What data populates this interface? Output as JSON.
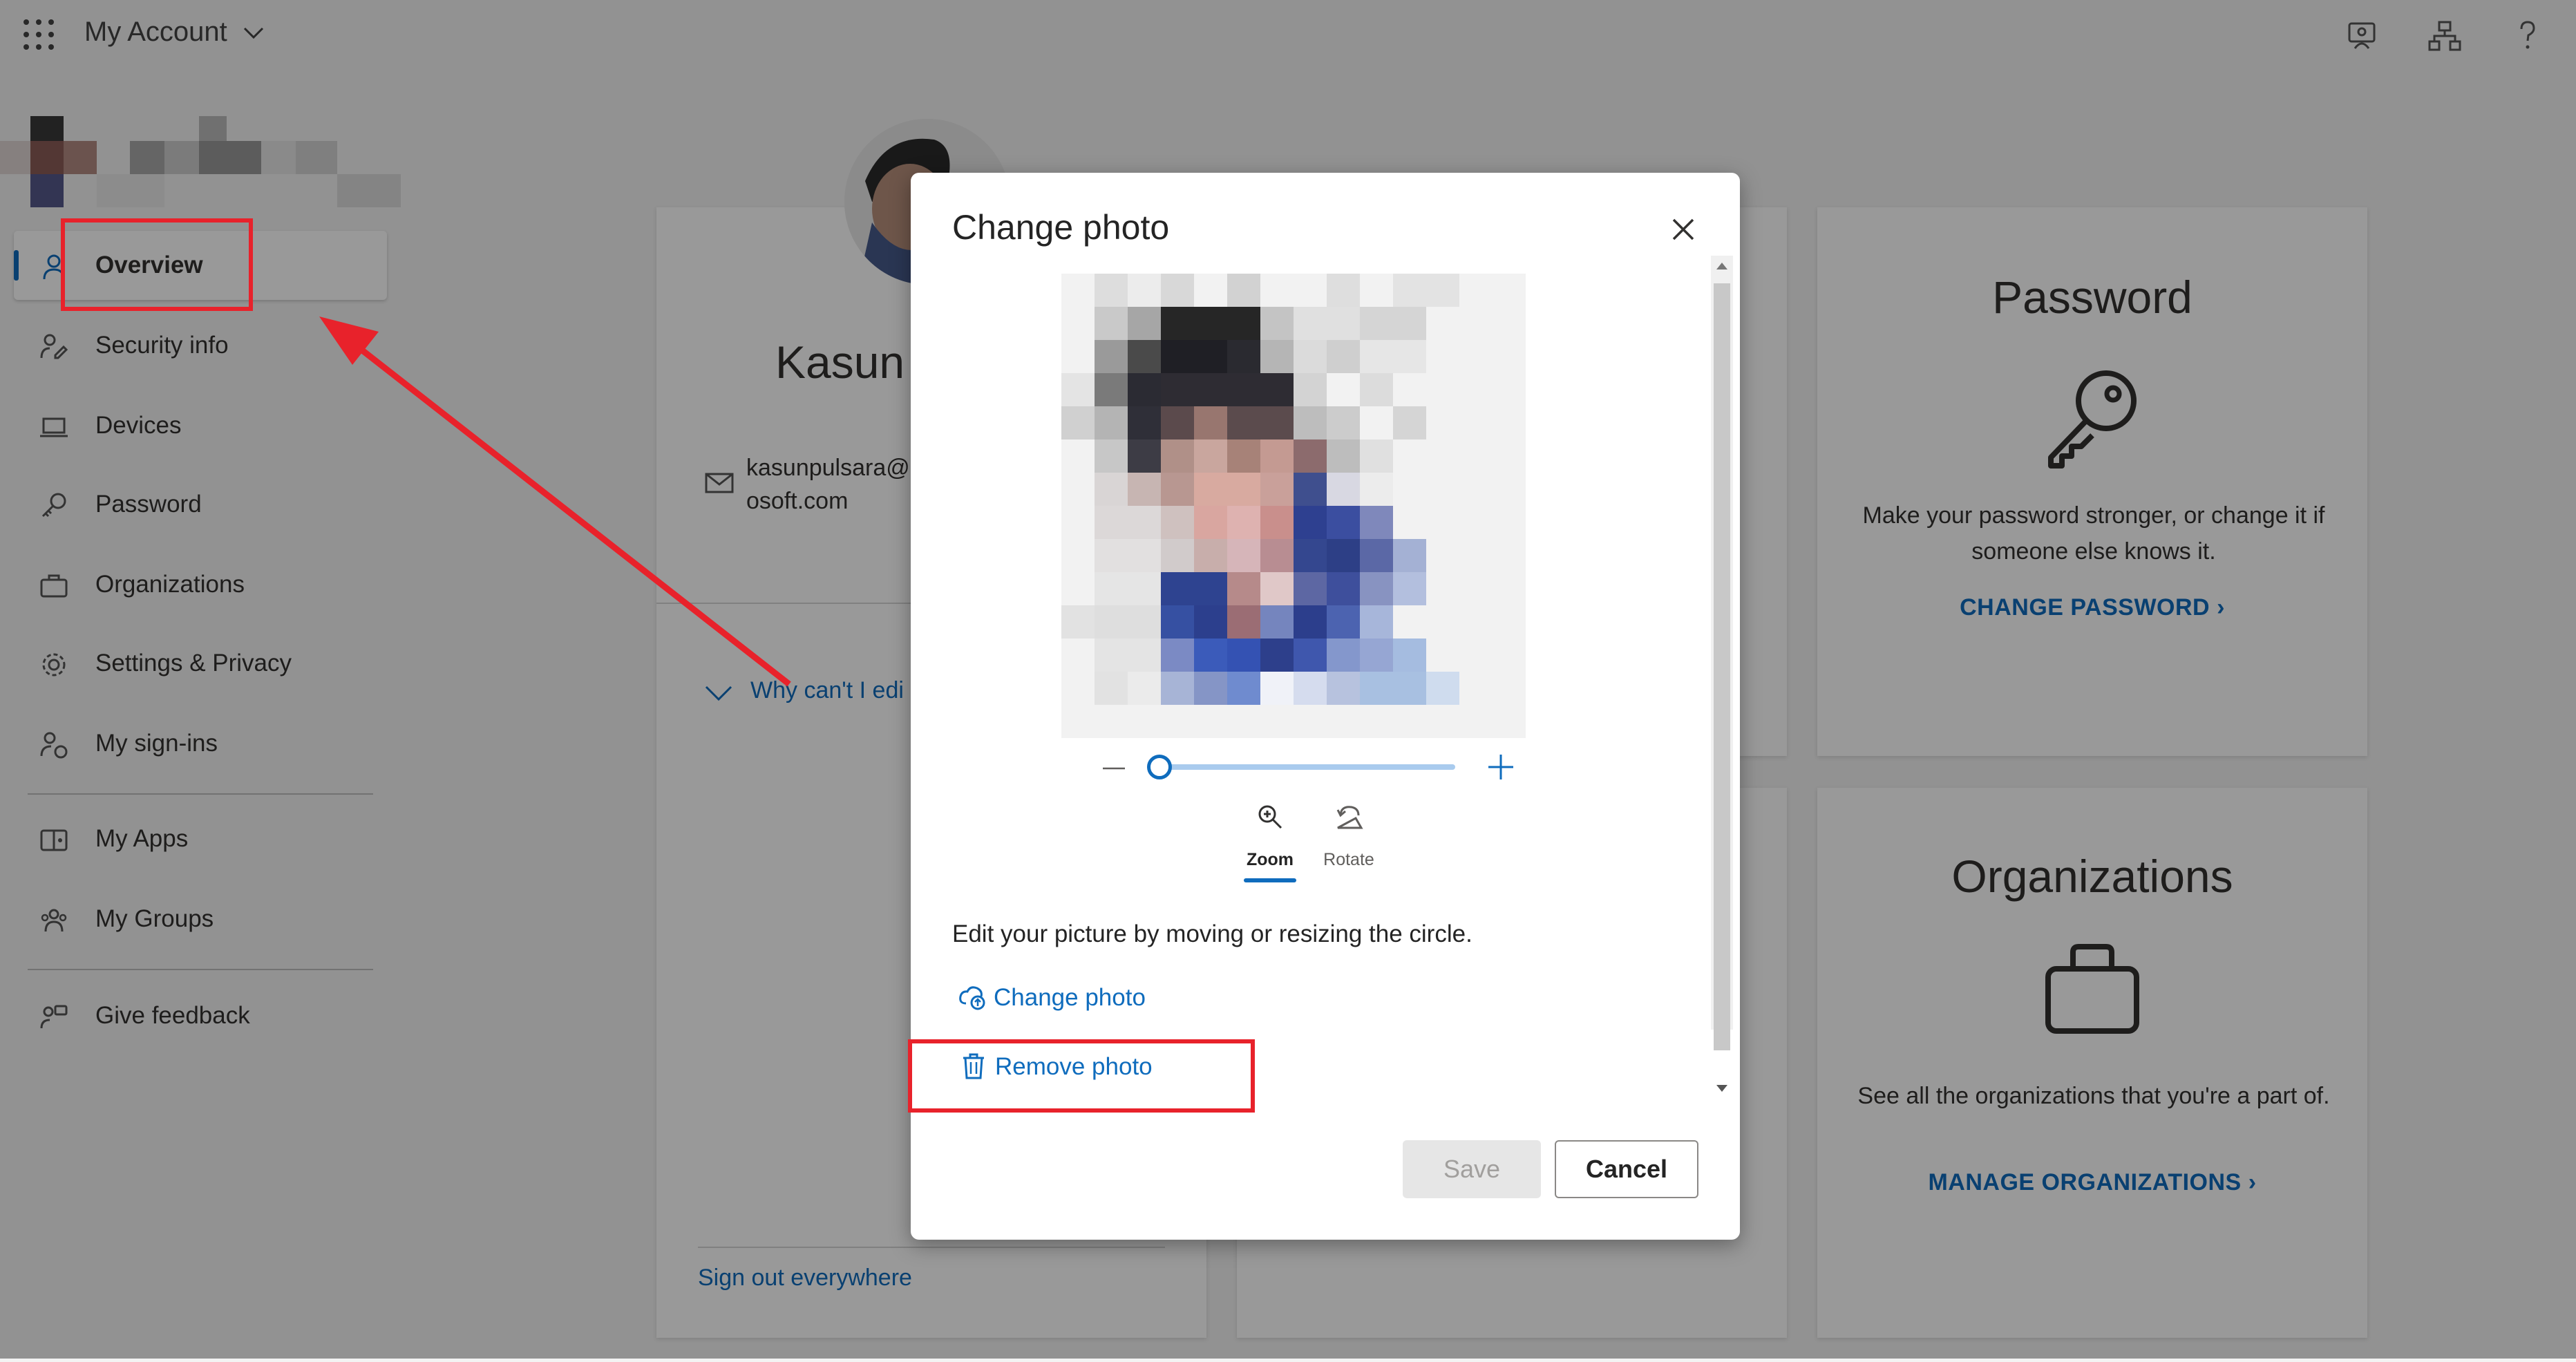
{
  "app": {
    "title": "My Account"
  },
  "sidebar": {
    "items": [
      {
        "label": "Overview"
      },
      {
        "label": "Security info"
      },
      {
        "label": "Devices"
      },
      {
        "label": "Password"
      },
      {
        "label": "Organizations"
      },
      {
        "label": "Settings & Privacy"
      },
      {
        "label": "My sign-ins"
      },
      {
        "label": "My Apps"
      },
      {
        "label": "My Groups"
      },
      {
        "label": "Give feedback"
      }
    ]
  },
  "profile": {
    "name": "Kasun",
    "email_line1": "kasunpulsara@",
    "email_line2": "osoft.com",
    "why_cant_edit": "Why can't I edi",
    "sign_out": "Sign out everywhere"
  },
  "cards": {
    "password": {
      "title": "Password",
      "desc": "Make your password stronger, or change it if someone else knows it.",
      "link": "CHANGE PASSWORD"
    },
    "organizations": {
      "title": "Organizations",
      "desc": "See all the organizations that you're a part of.",
      "link": "MANAGE ORGANIZATIONS"
    }
  },
  "dialog": {
    "title": "Change photo",
    "tools": {
      "zoom": "Zoom",
      "rotate": "Rotate"
    },
    "zoom_level": 0,
    "edit_text": "Edit your picture by moving or resizing the circle.",
    "change_photo": "Change photo",
    "remove_photo": "Remove photo",
    "save": "Save",
    "cancel": "Cancel"
  },
  "colors": {
    "accent": "#0f6cbd",
    "annotation": "#e8222b"
  },
  "icons": [
    "waffle-icon",
    "chevron-down-icon",
    "feedback-icon",
    "org-chart-icon",
    "help-icon",
    "person-icon",
    "key-icon",
    "briefcase-icon",
    "close-icon",
    "zoom-icon",
    "rotate-icon",
    "cloud-upload-icon",
    "trash-icon"
  ]
}
